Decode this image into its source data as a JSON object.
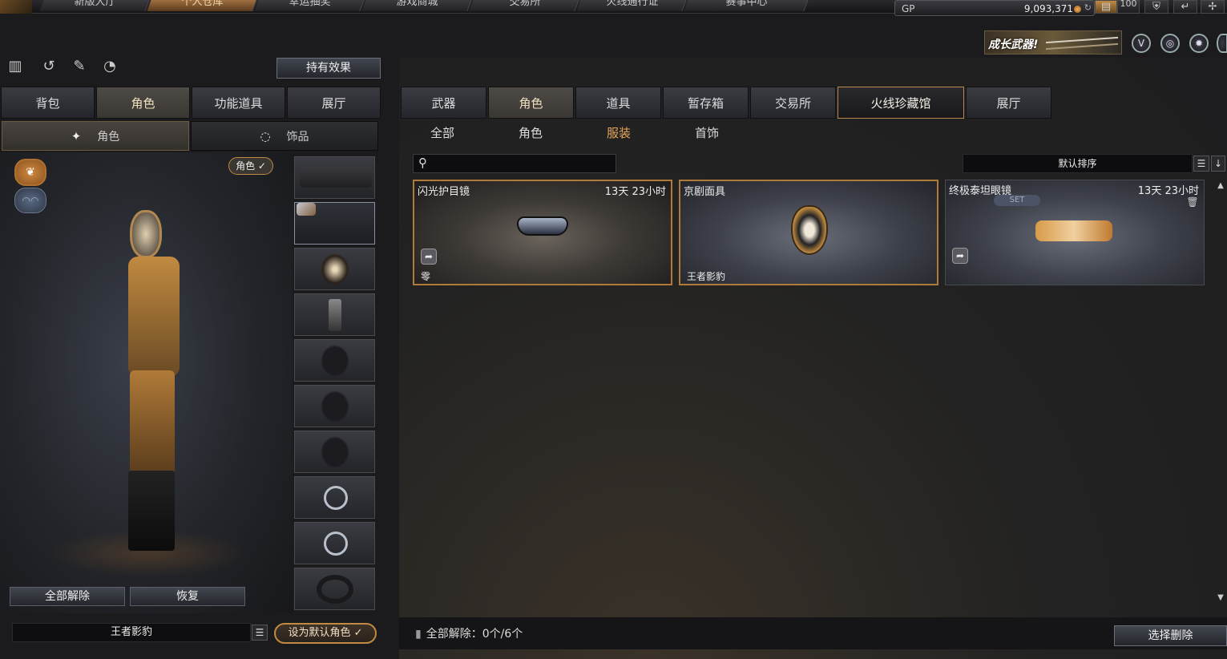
{
  "topnav": {
    "tabs": [
      {
        "label": "新版大厅",
        "active": false
      },
      {
        "label": "个人仓库",
        "active": true
      },
      {
        "label": "幸运抽奖",
        "active": false
      },
      {
        "label": "游戏商城",
        "active": false
      },
      {
        "label": "交易所",
        "active": false
      },
      {
        "label": "火线通行证",
        "active": false
      },
      {
        "label": "赛事中心",
        "active": false
      }
    ],
    "gp_label": "GP",
    "gp_value": "9,093,371",
    "level": "100",
    "icons": [
      "logo-icon",
      "shield-icon",
      "back-icon",
      "settings-icon"
    ]
  },
  "banner": {
    "text": "成长武器!"
  },
  "header_icons": [
    "v-badge-icon",
    "steering-icon",
    "gear-icon",
    "wrench-icon"
  ],
  "left": {
    "tool_icons": [
      "stats-icon",
      "history-icon",
      "character-edit-icon",
      "mouse-icon"
    ],
    "effect_button": "持有效果",
    "tabs": [
      {
        "label": "背包",
        "active": false
      },
      {
        "label": "角色",
        "active": true
      },
      {
        "label": "功能道具",
        "active": false
      },
      {
        "label": "展厅",
        "active": false
      }
    ],
    "subtabs": [
      {
        "label": "角色",
        "active": true
      },
      {
        "label": "饰品",
        "active": false
      }
    ],
    "role_check": "角色 ✓",
    "slots": [
      "gun",
      "wing",
      "mask",
      "radio",
      "armor",
      "vest",
      "pants",
      "ring",
      "ring",
      "bigring"
    ],
    "unequip_all": "全部解除",
    "restore": "恢复",
    "character_name": "王者影豹",
    "set_default": "设为默认角色 ✓"
  },
  "right": {
    "tabs": [
      {
        "label": "武器",
        "active": false
      },
      {
        "label": "角色",
        "active": true
      },
      {
        "label": "道具",
        "active": false
      },
      {
        "label": "暂存箱",
        "active": false
      },
      {
        "label": "交易所",
        "active": false
      },
      {
        "label": "火线珍藏馆",
        "active": false
      },
      {
        "label": "展厅",
        "active": false
      }
    ],
    "filters": [
      {
        "label": "全部",
        "active": false
      },
      {
        "label": "角色",
        "active": false
      },
      {
        "label": "服装",
        "active": true
      },
      {
        "label": "首饰",
        "active": false
      }
    ],
    "search_placeholder": "",
    "sort_label": "默认排序",
    "items": [
      {
        "name": "闪光护目镜",
        "time": "13天 23小时",
        "footer": "零",
        "equipped": true,
        "set": ""
      },
      {
        "name": "京剧面具",
        "time": "",
        "footer": "王者影豹",
        "equipped": true,
        "set": ""
      },
      {
        "name": "终极泰坦眼镜",
        "time": "13天 23小时",
        "footer": "",
        "equipped": false,
        "set": "SET"
      }
    ],
    "unequip_status": "全部解除：0个/6个",
    "select_delete": "选择删除"
  }
}
